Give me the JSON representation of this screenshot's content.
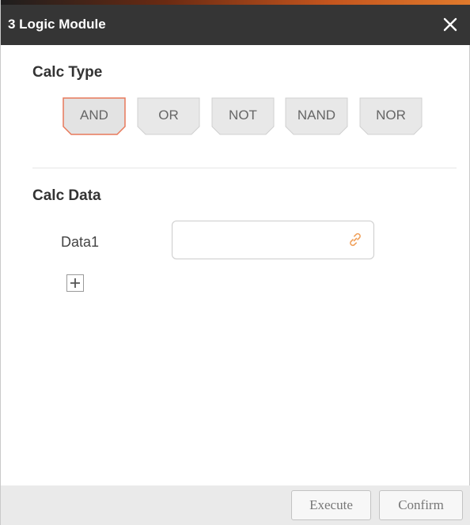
{
  "dialog": {
    "title": "3 Logic Module",
    "close_icon": "close-icon"
  },
  "calc_type": {
    "title": "Calc Type",
    "selected": "AND",
    "options": [
      "AND",
      "OR",
      "NOT",
      "NAND",
      "NOR"
    ]
  },
  "calc_data": {
    "title": "Calc Data",
    "rows": [
      {
        "label": "Data1",
        "value": "",
        "icon": "link-icon"
      }
    ],
    "add_icon": "plus-icon"
  },
  "footer": {
    "execute_label": "Execute",
    "confirm_label": "Confirm"
  },
  "colors": {
    "titlebar_bg": "#353535",
    "selected_border": "#e8795a",
    "button_bg": "#e8e8e8",
    "footer_bg": "#eaeaea"
  }
}
